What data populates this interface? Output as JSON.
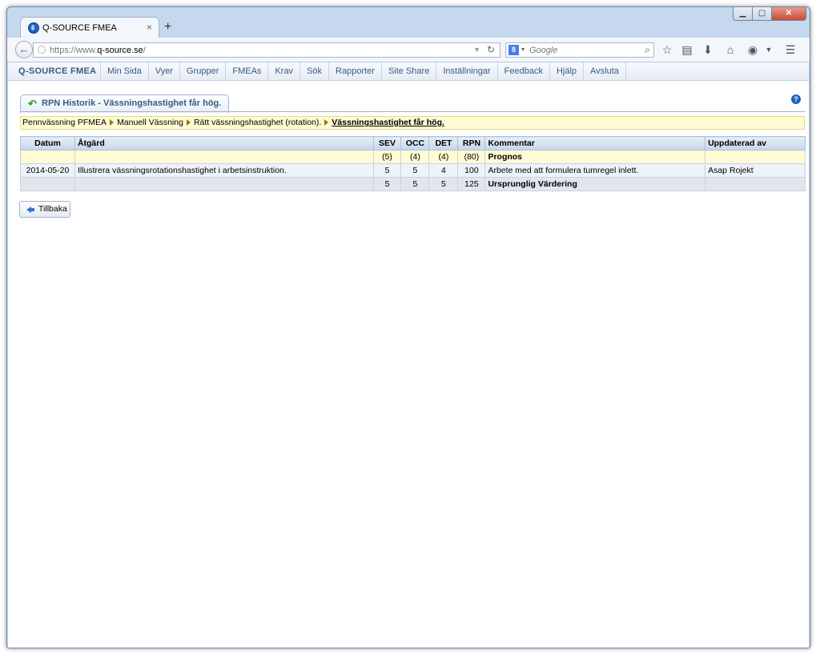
{
  "browser": {
    "tab_title": "Q-SOURCE FMEA",
    "tab_close": "×",
    "new_tab": "+",
    "url_prefix": "https://www.",
    "url_domain": "q-source.se",
    "url_suffix": "/",
    "search_placeholder": "Google",
    "search_engine_letter": "8"
  },
  "app": {
    "brand": "Q-SOURCE FMEA",
    "menu": [
      "Min Sida",
      "Vyer",
      "Grupper",
      "FMEAs",
      "Krav",
      "Sök",
      "Rapporter",
      "Site Share",
      "Inställningar",
      "Feedback",
      "Hjälp",
      "Avsluta"
    ]
  },
  "page": {
    "tab_title": "RPN Historik - Vässningshastighet får hög.",
    "breadcrumb": [
      "Pennvässning PFMEA",
      "Manuell Vässning",
      "Rätt vässningshastighet (rotation).",
      "Vässningshastighet får hög."
    ]
  },
  "table": {
    "headers": {
      "datum": "Datum",
      "atgard": "Åtgärd",
      "sev": "SEV",
      "occ": "OCC",
      "det": "DET",
      "rpn": "RPN",
      "kommentar": "Kommentar",
      "uppdaterad": "Uppdaterad av"
    },
    "prognos": {
      "datum": "",
      "atgard": "",
      "sev": "(5)",
      "occ": "(4)",
      "det": "(4)",
      "rpn": "(80)",
      "kommentar": "Prognos",
      "uppdaterad": ""
    },
    "rows": [
      {
        "datum": "2014-05-20",
        "atgard": "Illustrera vässningsrotationshastighet i arbetsinstruktion.",
        "sev": "5",
        "occ": "5",
        "det": "4",
        "rpn": "100",
        "kommentar": "Arbete med att formulera tumregel inlett.",
        "uppdaterad": "Asap Rojekt"
      }
    ],
    "original": {
      "datum": "",
      "atgard": "",
      "sev": "5",
      "occ": "5",
      "det": "5",
      "rpn": "125",
      "kommentar": "Ursprunglig Värdering",
      "uppdaterad": ""
    }
  },
  "back_button": "Tillbaka"
}
